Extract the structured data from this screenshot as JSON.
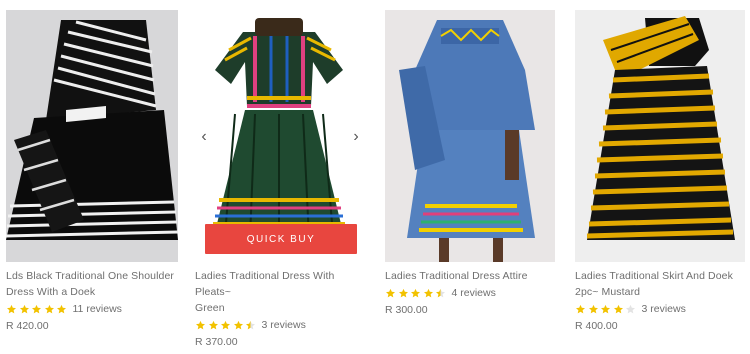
{
  "products": [
    {
      "title_line1": "Lds Black Traditional One Shoulder",
      "title_line2": "Dress With a Doek",
      "rating": 5,
      "reviews": "11 reviews",
      "price": "R 420.00"
    },
    {
      "title_line1": "Ladies Traditional Dress With Pleats~",
      "title_line2": "Green",
      "rating": 4.5,
      "reviews": "3 reviews",
      "price": "R 370.00",
      "quick_buy": "QUICK BUY",
      "prev_arrow": "‹",
      "next_arrow": "›"
    },
    {
      "title_line1": "Ladies Traditional Dress Attire",
      "title_line2": "",
      "rating": 4.5,
      "reviews": "4 reviews",
      "price": "R 300.00"
    },
    {
      "title_line1": "Ladies Traditional Skirt And Doek",
      "title_line2": "2pc~ Mustard",
      "rating": 4,
      "reviews": "3 reviews",
      "price": "R 400.00"
    }
  ],
  "colors": {
    "star": "#f2c200",
    "quick_buy_bg": "#e8463f",
    "text": "#6f6f6f"
  }
}
